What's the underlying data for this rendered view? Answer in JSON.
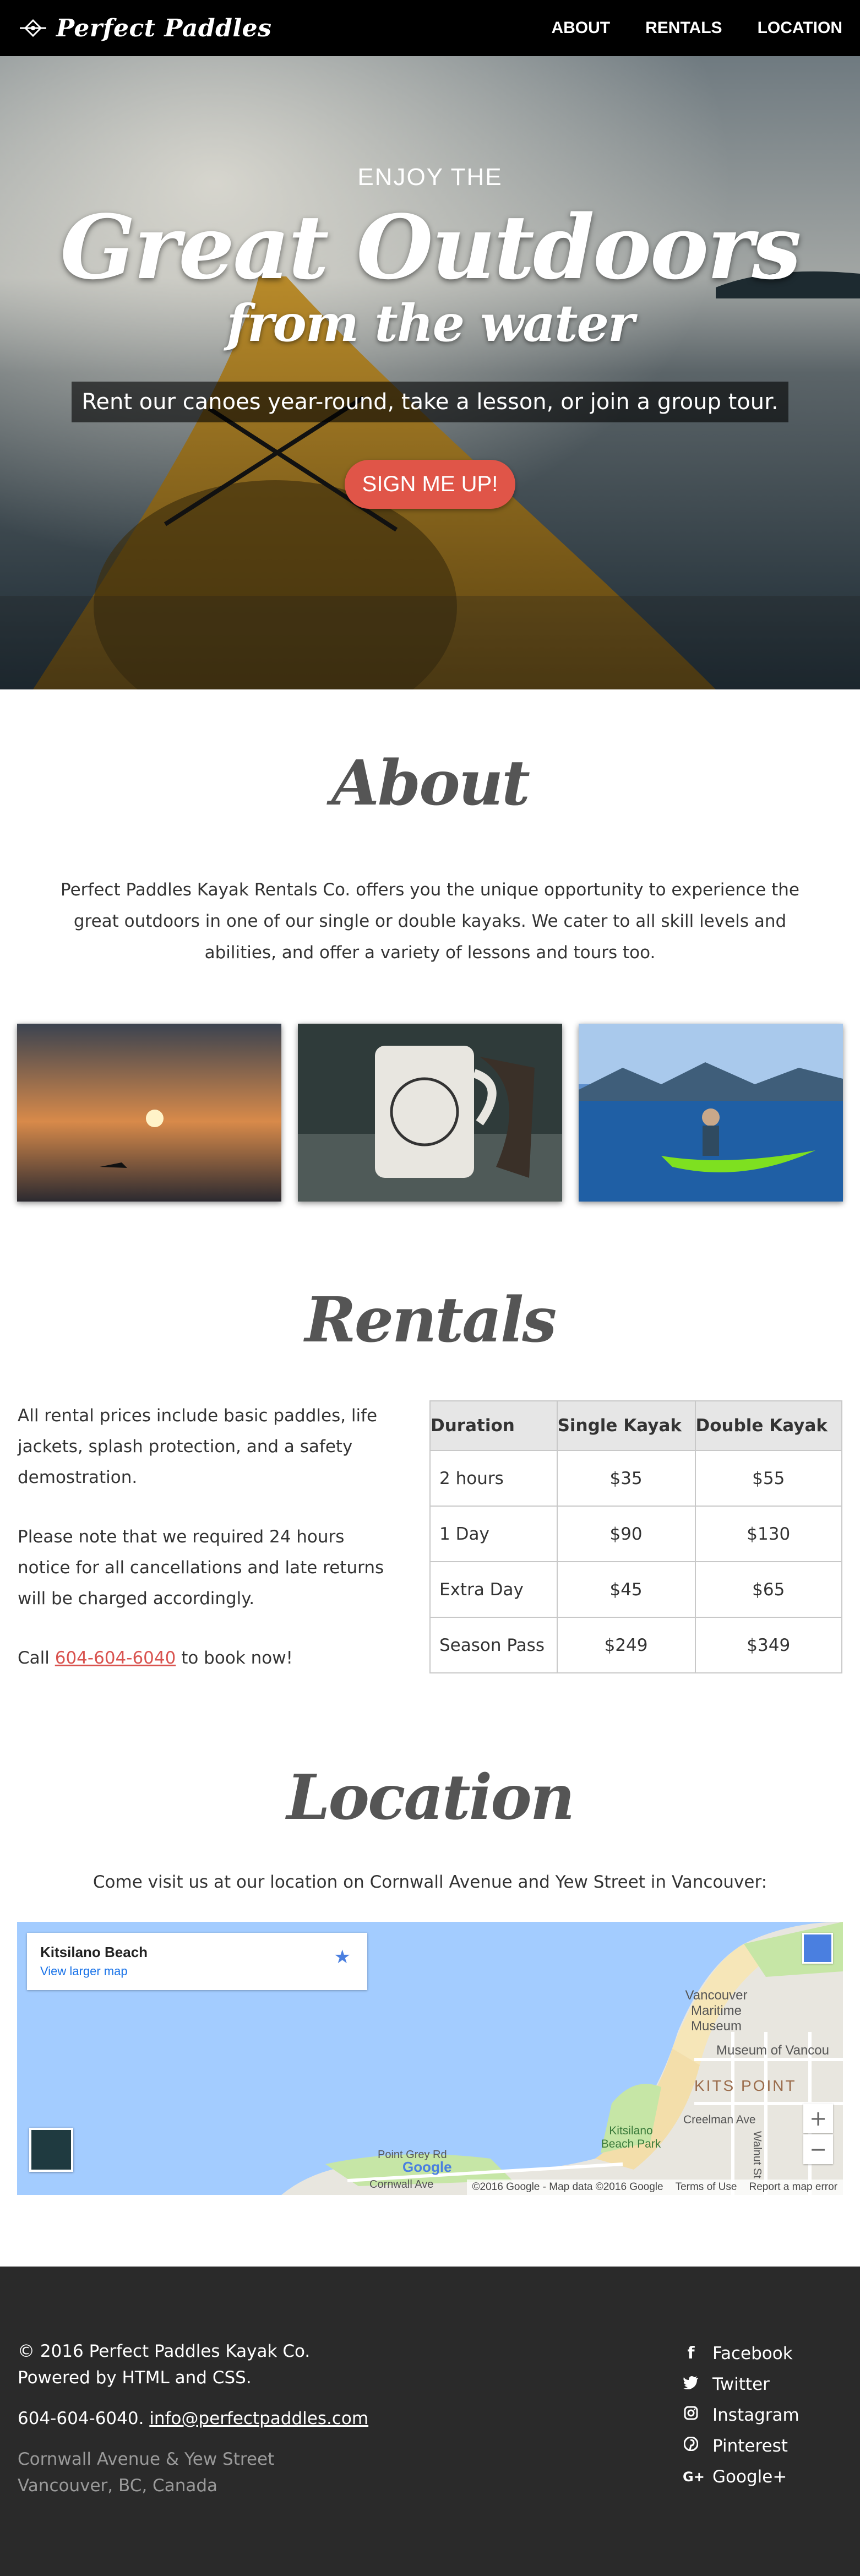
{
  "nav": {
    "brand": "Perfect Paddles",
    "links": [
      "ABOUT",
      "RENTALS",
      "LOCATION"
    ]
  },
  "hero": {
    "kicker": "ENJOY THE",
    "title": "Great Outdoors",
    "subtitle": "from the water",
    "tagline": "Rent our canoes year-round, take a lesson, or join a group tour.",
    "cta": "SIGN ME UP!"
  },
  "about": {
    "title": "About",
    "text": "Perfect Paddles Kayak Rentals Co. offers you the unique opportunity to experience the great outdoors in one of our single or double kayaks. We cater to all skill levels and abilities, and offer a variety of lessons and tours too."
  },
  "rentals": {
    "title": "Rentals",
    "para1": "All rental prices include basic paddles, life jackets, splash protection, and a safety demostration.",
    "para2": "Please note that we required 24 hours notice for all cancellations and late returns will be charged accordingly.",
    "call_prefix": "Call ",
    "phone": "604-604-6040",
    "call_suffix": " to book now!",
    "table": {
      "headers": [
        "Duration",
        "Single Kayak",
        "Double Kayak"
      ],
      "rows": [
        [
          "2 hours",
          "$35",
          "$55"
        ],
        [
          "1 Day",
          "$90",
          "$130"
        ],
        [
          "Extra Day",
          "$45",
          "$65"
        ],
        [
          "Season Pass",
          "$249",
          "$349"
        ]
      ]
    }
  },
  "location": {
    "title": "Location",
    "text": "Come visit us at our location on Cornwall Avenue and Yew Street in Vancouver:",
    "map": {
      "place": "Kitsilano Beach",
      "larger_map": "View larger map",
      "labels": [
        "Vancouver Maritime Museum",
        "Museum of Vancou",
        "KITS POINT",
        "Creelman Ave",
        "Kitsilano Beach Park",
        "Point Grey Rd",
        "Cornwall Ave",
        "Walnut St"
      ],
      "attribution": [
        "©2016 Google - Map data ©2016 Google",
        "Terms of Use",
        "Report a map error"
      ],
      "zoom_in": "+",
      "zoom_out": "−",
      "google": "Google"
    }
  },
  "footer": {
    "copyright": "© 2016 Perfect Paddles Kayak Co.",
    "powered": "Powered by HTML and CSS.",
    "phone": "604-604-6040. ",
    "email": "info@perfectpaddles.com",
    "address1": "Cornwall Avenue & Yew Street",
    "address2": "Vancouver, BC, Canada",
    "social": [
      {
        "label": "Facebook",
        "icon": "facebook-icon"
      },
      {
        "label": "Twitter",
        "icon": "twitter-icon"
      },
      {
        "label": "Instagram",
        "icon": "instagram-icon"
      },
      {
        "label": "Pinterest",
        "icon": "pinterest-icon"
      },
      {
        "label": "Google+",
        "icon": "google-plus-icon"
      }
    ]
  },
  "colors": {
    "accent": "#e05548",
    "footer_bg": "#2a2a2a",
    "link": "#d9534f"
  }
}
